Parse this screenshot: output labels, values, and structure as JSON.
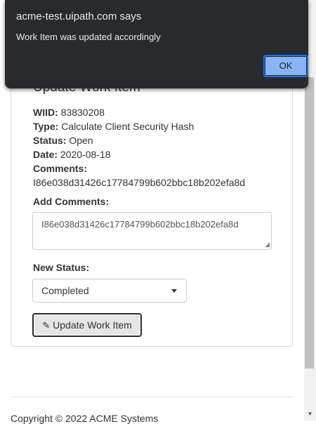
{
  "dialog": {
    "title": "acme-test.uipath.com says",
    "message": "Work Item was updated accordingly",
    "ok_label": "OK"
  },
  "card": {
    "title": "Update Work Item",
    "wiid_label": "WIID:",
    "wiid_value": "83830208",
    "type_label": "Type:",
    "type_value": "Calculate Client Security Hash",
    "status_label": "Status:",
    "status_value": "Open",
    "date_label": "Date:",
    "date_value": "2020-08-18",
    "comments_label": "Comments:",
    "comments_value": "I86e038d31426c17784799b602bbc18b202efa8d"
  },
  "form": {
    "add_comments_label": "Add Comments:",
    "add_comments_value": "I86e038d31426c17784799b602bbc18b202efa8d",
    "new_status_label": "New Status:",
    "new_status_value": "Completed",
    "submit_label": "Update Work Item"
  },
  "footer": {
    "copyright": "Copyright © 2022 ACME Systems"
  }
}
